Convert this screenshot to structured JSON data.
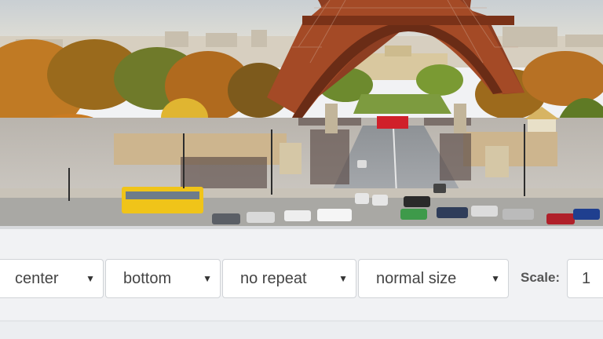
{
  "photo": {
    "subject": "eiffel-tower-paris-scene"
  },
  "controls": {
    "position_x": {
      "value": "center"
    },
    "position_y": {
      "value": "bottom"
    },
    "repeat": {
      "value": "no repeat"
    },
    "size": {
      "value": "normal size"
    },
    "scale": {
      "label": "Scale:",
      "value": "1"
    },
    "dropdown_icon": "caret-down-icon"
  },
  "colors": {
    "panel_bg": "#f1f2f4",
    "field_border": "#d0d3d7",
    "text": "#444444"
  }
}
